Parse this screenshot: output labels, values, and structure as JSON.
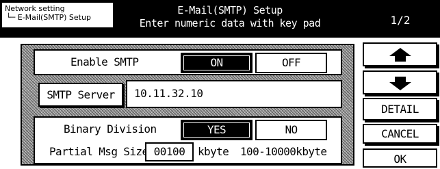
{
  "header": {
    "breadcrumb_line1": "Network setting",
    "breadcrumb_line2": "└─ E-Mail(SMTP) Setup",
    "title": "E-Mail(SMTP) Setup",
    "subtitle": "Enter numeric data with key pad",
    "page_indicator": "1/2"
  },
  "smtp": {
    "label": "Enable SMTP",
    "on_label": "ON",
    "off_label": "OFF",
    "selected": "ON"
  },
  "server": {
    "button_label": "SMTP Server",
    "value": "10.11.32.10"
  },
  "binary": {
    "label": "Binary Division",
    "yes_label": "YES",
    "no_label": "NO",
    "selected": "YES",
    "size_label": "Partial Msg Size",
    "size_value": "00100",
    "unit": "kbyte",
    "range": "100-10000kbyte"
  },
  "side": {
    "up_icon": "arrow-up-icon",
    "down_icon": "arrow-down-icon",
    "detail_label": "DETAIL",
    "cancel_label": "CANCEL",
    "ok_label": "OK"
  }
}
